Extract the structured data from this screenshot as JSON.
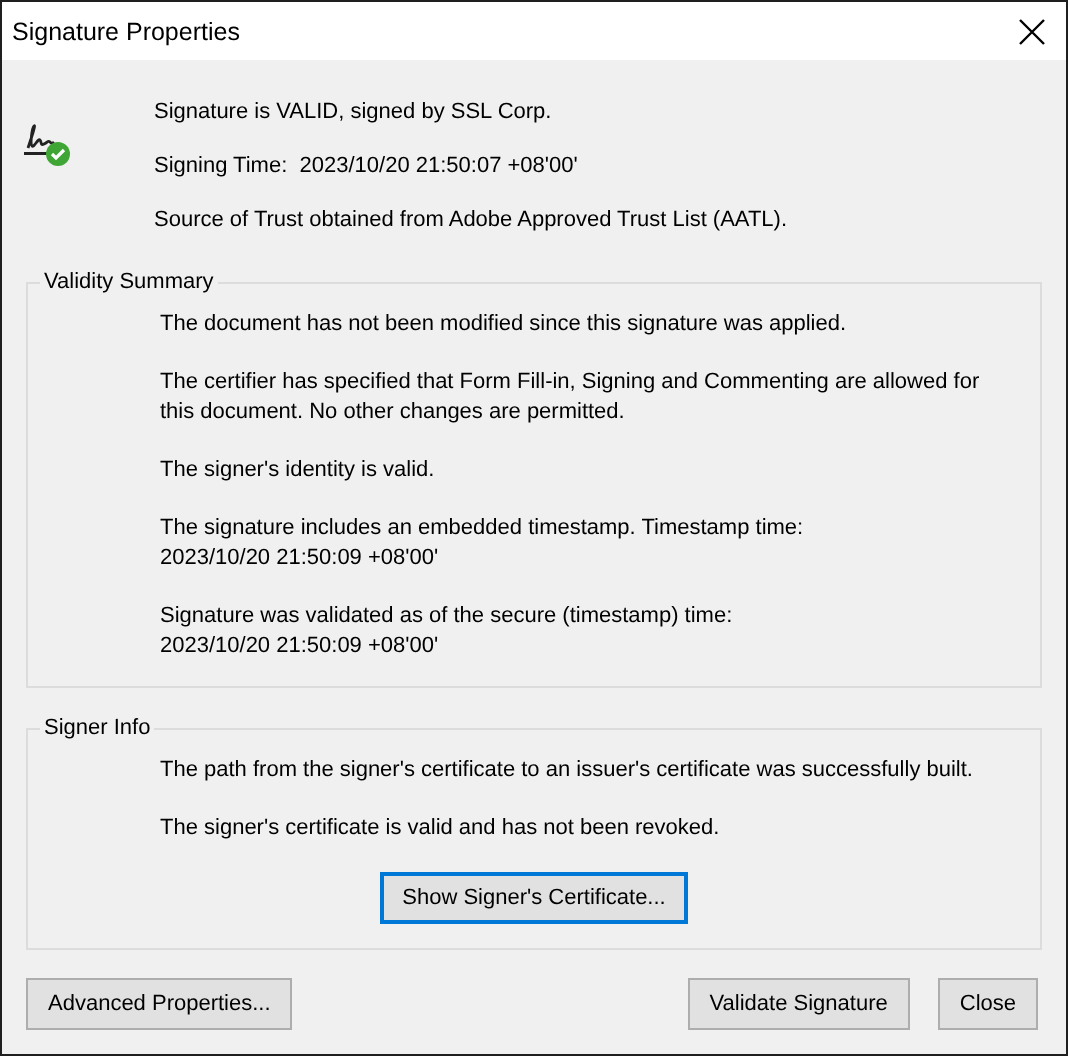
{
  "window": {
    "title": "Signature Properties"
  },
  "summary": {
    "kind": "valid",
    "lines": [
      "Signature is VALID, signed by SSL Corp.",
      "Signing Time:  2023/10/20 21:50:07 +08'00'",
      "Source of Trust obtained from Adobe Approved Trust List (AATL)."
    ]
  },
  "sections": [
    {
      "title": "Validity Summary",
      "paragraphs": [
        [
          "The document has not been modified since this signature was applied."
        ],
        [
          "The certifier has specified that Form Fill-in, Signing and Commenting are allowed for",
          "this document. No other changes are permitted."
        ],
        [
          "The signer's identity is valid."
        ],
        [
          "The signature includes an embedded timestamp. Timestamp time:",
          "2023/10/20 21:50:09 +08'00'"
        ],
        [
          "Signature was validated as of the secure (timestamp) time:",
          "2023/10/20 21:50:09 +08'00'"
        ]
      ]
    },
    {
      "title": "Signer Info",
      "paragraphs": [
        [
          "The path from the signer's certificate to an issuer's certificate was successfully built."
        ],
        [
          "The signer's certificate is valid and has not been revoked."
        ]
      ],
      "button": {
        "label": "Show Signer's Certificate...",
        "focused": true
      }
    }
  ],
  "footer": {
    "left_buttons": [
      {
        "label": "Advanced Properties...",
        "focused": false
      }
    ],
    "right_buttons": [
      {
        "label": "Validate Signature",
        "focused": false
      },
      {
        "label": "Close",
        "focused": false
      }
    ]
  }
}
